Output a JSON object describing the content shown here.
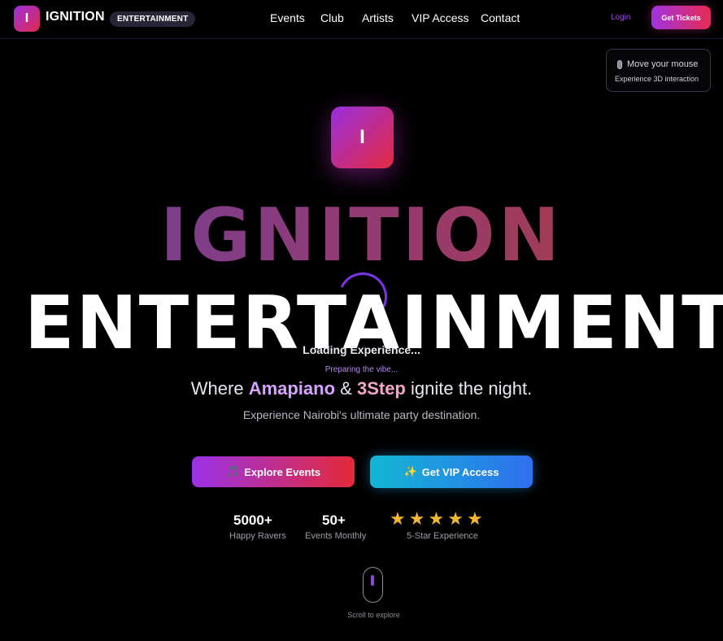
{
  "nav": {
    "logo_letter": "I",
    "brand": "IGNITION",
    "badge": "ENTERTAINMENT",
    "links": [
      "Events",
      "Club",
      "Artists",
      "VIP Access",
      "Contact"
    ],
    "login": "Login",
    "cta": "Get Tickets"
  },
  "hint": {
    "icon": "mouse-icon",
    "title": "Move your mouse",
    "subtitle": "Experience 3D interaction"
  },
  "hero": {
    "logo_letter": "I",
    "title_line1": "IGNITION",
    "title_line2": "ENTERTAINMENT",
    "loading": "Loading Experience...",
    "preparing": "Preparing the vibe...",
    "tagline": {
      "pre": "Where ",
      "genre1": "Amapiano",
      "amp": " & ",
      "genre2": "3Step",
      "post": " ignite the night."
    },
    "subtitle": "Experience Nairobi's ultimate party destination.",
    "buttons": {
      "events_icon": "🎵",
      "events_label": "Explore Events",
      "vip_icon": "✨",
      "vip_label": "Get VIP Access"
    },
    "stats": [
      {
        "value": "5000+",
        "label": "Happy Ravers"
      },
      {
        "value": "50+",
        "label": "Events Monthly"
      }
    ],
    "rating": {
      "stars": 5,
      "label": "5-Star Experience"
    },
    "scroll_label": "Scroll to explore"
  },
  "colors": {
    "accent_purple": "#9b2fe0",
    "accent_red": "#e22a4a",
    "accent_cyan": "#12b6d4",
    "star": "#f4b731"
  }
}
